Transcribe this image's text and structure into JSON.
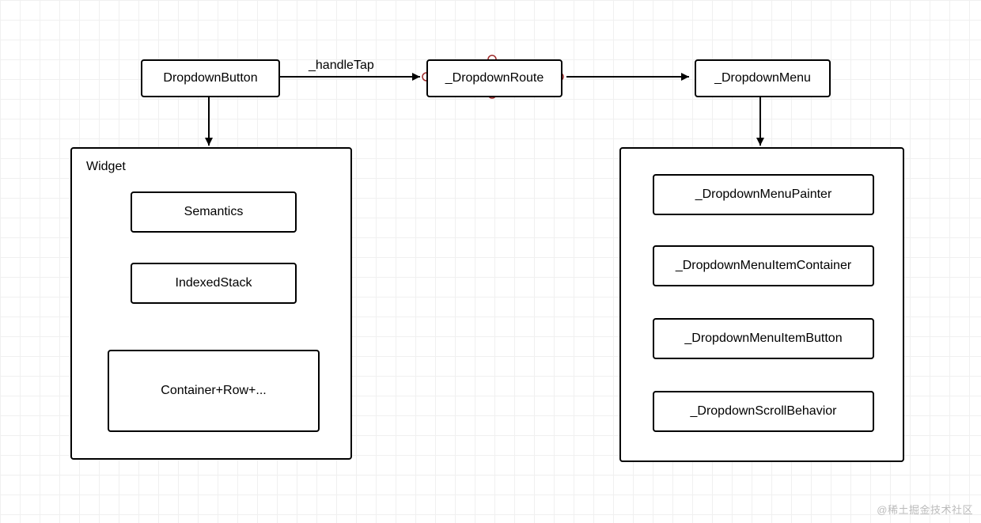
{
  "top_nodes": {
    "dropdown_button": "DropdownButton",
    "dropdown_route": "_DropdownRoute",
    "dropdown_menu": "_DropdownMenu"
  },
  "edge_labels": {
    "handle_tap": "_handleTap"
  },
  "left_container": {
    "title": "Widget",
    "items": {
      "semantics": "Semantics",
      "indexed_stack": "IndexedStack",
      "container_row": "Container+Row+..."
    }
  },
  "right_container": {
    "items": {
      "menu_painter": "_DropdownMenuPainter",
      "menu_item_container": "_DropdownMenuItemContainer",
      "menu_item_button": "_DropdownMenuItemButton",
      "scroll_behavior": "_DropdownScrollBehavior"
    }
  },
  "watermark": "@稀土掘金技术社区"
}
